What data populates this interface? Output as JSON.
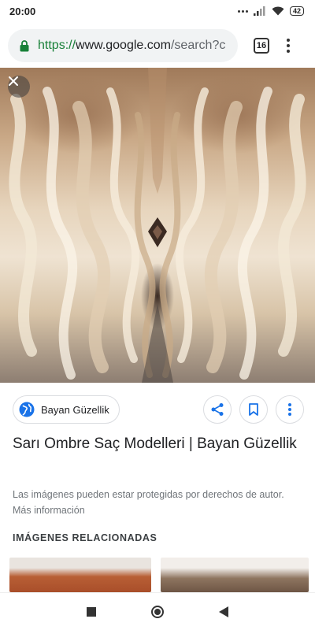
{
  "status_bar": {
    "time": "20:00",
    "battery": "42"
  },
  "browser": {
    "url": {
      "scheme": "https://",
      "host": "www.google.com",
      "path": "/search?c"
    },
    "tab_count": "16"
  },
  "result": {
    "source_label": "Bayan Güzellik",
    "title": "Sarı Ombre Saç Modelleri | Bayan Güzellik",
    "copyright_notice": "Las imágenes pueden estar protegidas por derechos de autor. Más información",
    "related_heading": "IMÁGENES RELACIONADAS"
  },
  "icons": {
    "close": "close-icon",
    "share": "share-icon",
    "bookmark": "bookmark-icon",
    "more": "more-vert-icon",
    "globe": "globe-icon",
    "lock": "lock-icon"
  },
  "colors": {
    "secure_green": "#188038",
    "link_blue": "#1a73e8",
    "chip_border": "#dadce0"
  }
}
